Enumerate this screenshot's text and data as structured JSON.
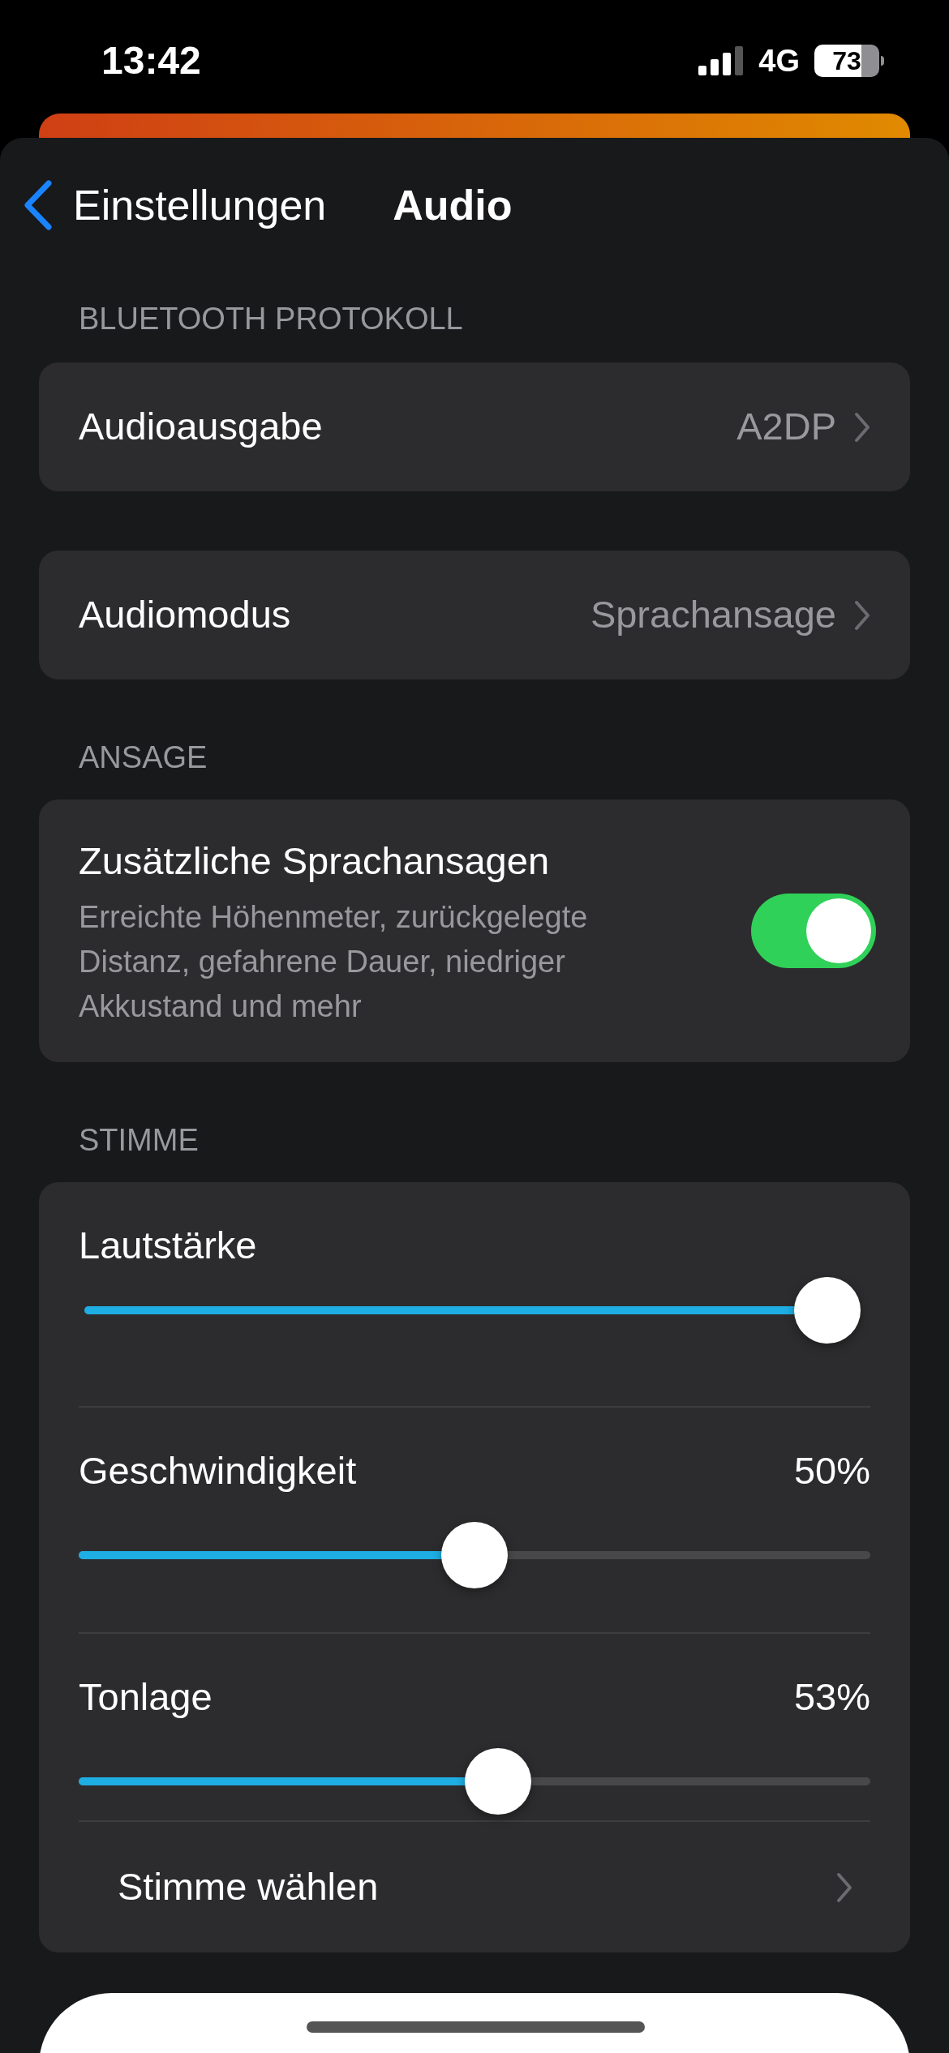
{
  "status_bar": {
    "time": "13:42",
    "network": "4G",
    "battery": "73"
  },
  "nav": {
    "back": "Einstellungen",
    "title": "Audio"
  },
  "sections": [
    {
      "header": "BLUETOOTH PROTOKOLL",
      "rows": [
        {
          "kind": "link",
          "label": "Audioausgabe",
          "value": "A2DP"
        }
      ]
    },
    {
      "rows": [
        {
          "kind": "link",
          "label": "Audiomodus",
          "value": "Sprachansage"
        }
      ]
    },
    {
      "header": "ANSAGE",
      "rows": [
        {
          "kind": "toggle",
          "label": "Zusätzliche Sprachansagen",
          "detail": "Erreichte Höhenmeter, zurückgelegte Distanz, gefahrene Dauer, niedriger Akkustand und mehr",
          "on": true
        }
      ]
    },
    {
      "header": "STIMME",
      "rows": [
        {
          "kind": "slider",
          "label": "Lautstärke",
          "level": 1.0
        },
        {
          "kind": "slider",
          "label": "Geschwindigkeit",
          "reading": "50%",
          "level": 0.5
        },
        {
          "kind": "slider",
          "label": "Tonlage",
          "reading": "53%",
          "level": 0.53
        },
        {
          "kind": "nav",
          "label": "Stimme wählen"
        }
      ]
    }
  ]
}
